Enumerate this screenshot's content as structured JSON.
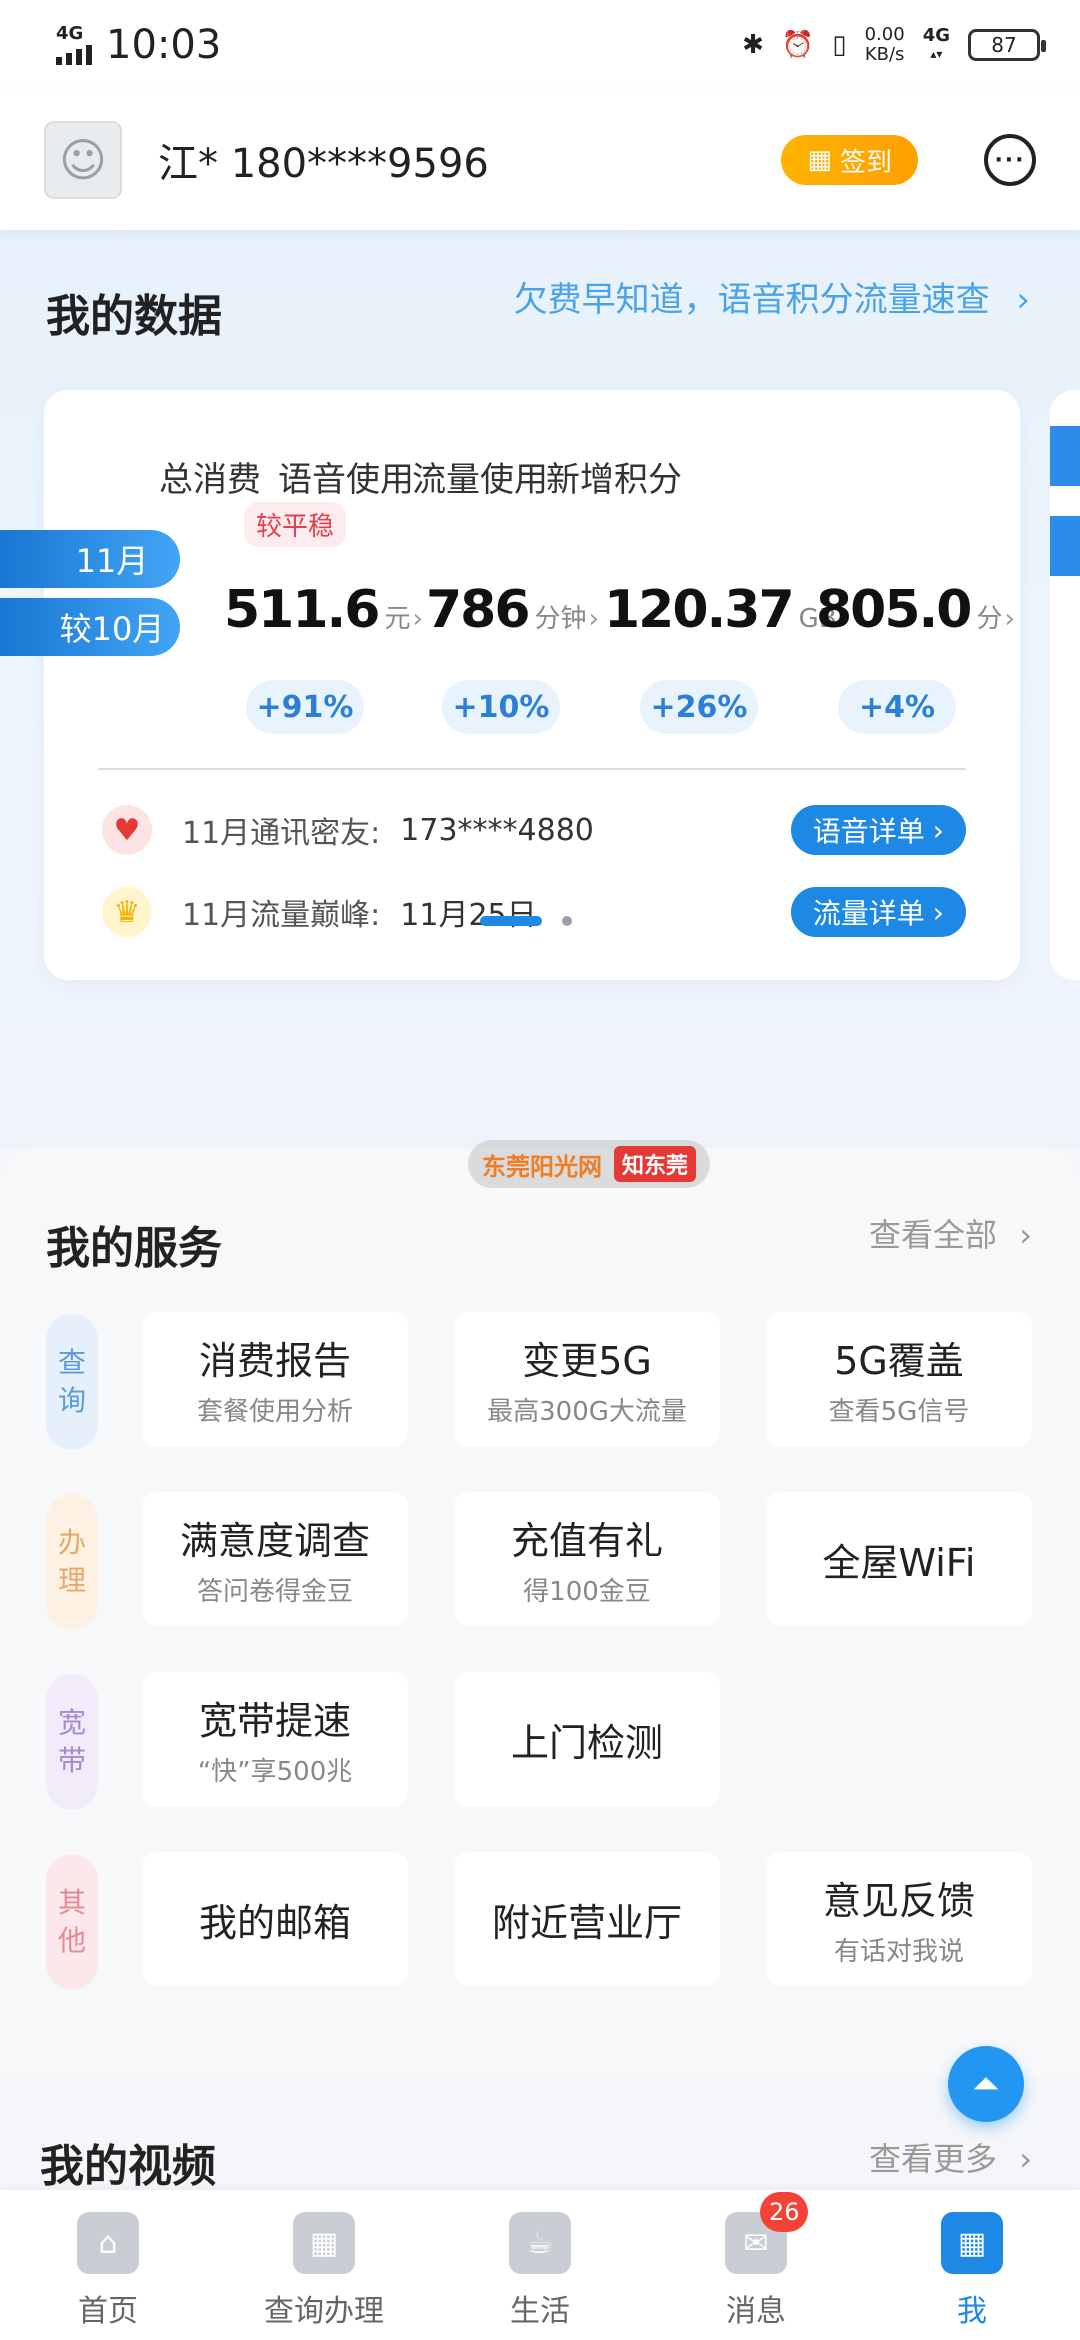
{
  "status_bar": {
    "network": "4G",
    "time": "10:03",
    "speed_value": "0.00",
    "speed_unit": "KB/s",
    "network2": "4G",
    "battery": "87"
  },
  "header": {
    "user": "江* 180****9596",
    "signin_label": "签到",
    "chat_icon": "chat-icon"
  },
  "data_section": {
    "title": "我的数据",
    "link": "欠费早知道，语音积分流量速查",
    "trend_tag": "较平稳",
    "month_label": "11月",
    "compare_label": "较10月",
    "columns": [
      {
        "head": "总消费",
        "value": "511.6",
        "unit": "元",
        "change": "+91%"
      },
      {
        "head": "语音使用",
        "value": "786",
        "unit": "分钟",
        "change": "+10%"
      },
      {
        "head": "流量使用",
        "value": "120.37",
        "unit": "GB",
        "change": "+26%"
      },
      {
        "head": "新增积分",
        "value": "805.0",
        "unit": "分",
        "change": "+4%"
      }
    ],
    "friend_label": "11月通讯密友:",
    "friend_value": "173****4880",
    "voice_btn": "语音详单",
    "peak_label": "11月流量巅峰:",
    "peak_value": "11月25日",
    "data_btn": "流量详单"
  },
  "watermark": {
    "a": "东莞阳光网",
    "b": "知东莞"
  },
  "services": {
    "title": "我的服务",
    "more": "查看全部",
    "categories": [
      {
        "label": [
          "查",
          "询"
        ],
        "bg": "#e6f0fb",
        "color": "#5b9bd8"
      },
      {
        "label": [
          "办",
          "理"
        ],
        "bg": "#fdf1e3",
        "color": "#e7a96a"
      },
      {
        "label": [
          "宽",
          "带"
        ],
        "bg": "#f1ebfa",
        "color": "#a48ad3"
      },
      {
        "label": [
          "其",
          "他"
        ],
        "bg": "#fce8ea",
        "color": "#e38b95"
      }
    ],
    "rows": [
      [
        {
          "title": "消费报告",
          "sub": "套餐使用分析"
        },
        {
          "title": "变更5G",
          "sub": "最高300G大流量"
        },
        {
          "title": "5G覆盖",
          "sub": "查看5G信号"
        }
      ],
      [
        {
          "title": "满意度调查",
          "sub": "答问卷得金豆"
        },
        {
          "title": "充值有礼",
          "sub": "得100金豆"
        },
        {
          "title": "全屋WiFi",
          "sub": ""
        }
      ],
      [
        {
          "title": "宽带提速",
          "sub": "“快”享500兆"
        },
        {
          "title": "上门检测",
          "sub": ""
        }
      ],
      [
        {
          "title": "我的邮箱",
          "sub": ""
        },
        {
          "title": "附近营业厅",
          "sub": ""
        },
        {
          "title": "意见反馈",
          "sub": "有话对我说"
        }
      ]
    ]
  },
  "videos": {
    "title": "我的视频",
    "more": "查看更多"
  },
  "bottom_nav": [
    {
      "label": "首页",
      "icon": "home-icon"
    },
    {
      "label": "查询办理",
      "icon": "grid-icon"
    },
    {
      "label": "生活",
      "icon": "cup-icon"
    },
    {
      "label": "消息",
      "icon": "message-icon",
      "badge": "26"
    },
    {
      "label": "我",
      "icon": "profile-calendar-icon",
      "active": true
    }
  ]
}
